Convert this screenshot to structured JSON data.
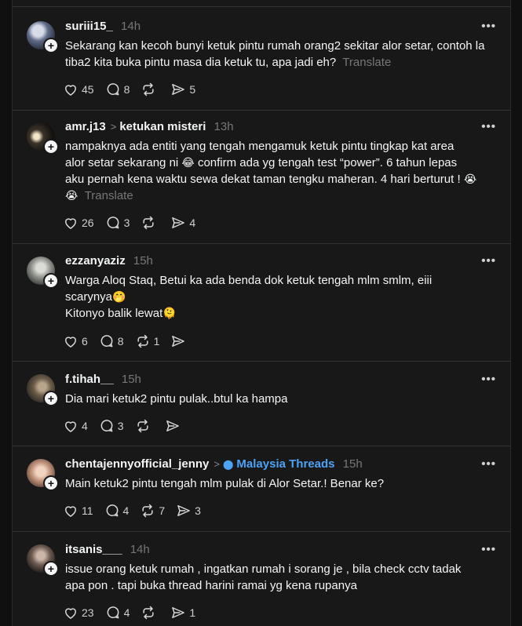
{
  "posts": [
    {
      "username": "suriii15_",
      "time": "14h",
      "text": "Sekarang kan kecoh bunyi ketuk pintu rumah orang2 sekitar alor setar, contoh la tiba2 kita buka pintu masa dia ketuk tu, apa jadi eh?",
      "translate": "Translate",
      "likes": "45",
      "replies": "8",
      "reposts": "",
      "shares": "5"
    },
    {
      "username": "amr.j13",
      "topic": "ketukan misteri",
      "time": "13h",
      "text_line1": "nampaknya ada entiti yang tengah mengamuk ketuk pintu tingkap kat area",
      "text_line2a": "alor setar sekarang ni ",
      "emoji_a": "😂",
      "text_line2b": " confirm ada yg tengah test “power”. 6 tahun lepas",
      "text_line3a": "aku pernah kena waktu sewa dekat taman tengku maheran. 4 hari berturut ! ",
      "emoji_b": "😭",
      "emoji_c": "😭",
      "translate": "Translate",
      "likes": "26",
      "replies": "3",
      "reposts": "",
      "shares": "4"
    },
    {
      "username": "ezzanyaziz",
      "time": "15h",
      "text_line1": "Warga Aloq Staq, Betui ka ada benda dok ketuk tengah mlm smlm, eiii",
      "text_line2": "scarynya",
      "emoji_a": "🤭",
      "text_line3": "Kitonyo balik lewat",
      "emoji_b": "🫠",
      "likes": "6",
      "replies": "8",
      "reposts": "1",
      "shares": ""
    },
    {
      "username": "f.tihah__",
      "time": "15h",
      "text": "Dia mari ketuk2 pintu pulak..btul ka hampa",
      "likes": "4",
      "replies": "3",
      "reposts": "",
      "shares": ""
    },
    {
      "username": "chentajennyofficial_jenny",
      "topic": "Malaysia Threads",
      "time": "15h",
      "text": "Main ketuk2 pintu tengah mlm pulak di Alor Setar.! Benar ke?",
      "likes": "11",
      "replies": "4",
      "reposts": "7",
      "shares": "3"
    },
    {
      "username": "itsanis___",
      "time": "14h",
      "text_line1": "issue orang ketuk rumah , ingatkan rumah i sorang je , bila check cctv tadak",
      "text_line2": "apa pon . tapi buka thread harini ramai yg kena rupanya",
      "likes": "23",
      "replies": "4",
      "reposts": "",
      "shares": "1"
    }
  ],
  "more_icon": "•••",
  "colors": {
    "background": "#181818",
    "accent": "#4da2f6",
    "muted": "#777777"
  }
}
